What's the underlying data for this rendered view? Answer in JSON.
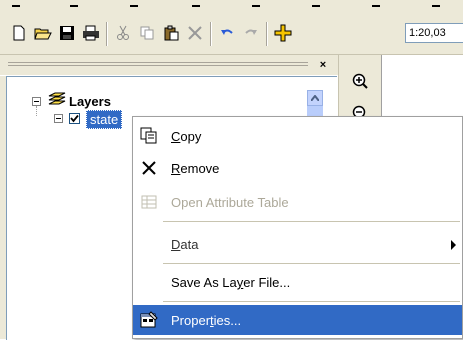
{
  "toolbar": {
    "scale_value": "1:20,03"
  },
  "toc": {
    "close_glyph": "×",
    "root_label": "Layers",
    "layer_label": "state",
    "layer_checked": true
  },
  "menu": {
    "items": [
      {
        "label_pre": "",
        "label_ul": "C",
        "label_post": "opy",
        "icon": "copy-icon",
        "enabled": true
      },
      {
        "label_pre": "",
        "label_ul": "R",
        "label_post": "emove",
        "icon": "remove-icon",
        "enabled": true
      },
      {
        "label_pre": "Open Attribute Table",
        "label_ul": "",
        "label_post": "",
        "icon": "table-icon",
        "enabled": false
      },
      {
        "label_pre": "",
        "label_ul": "D",
        "label_post": "ata",
        "icon": "",
        "enabled": true
      },
      {
        "label_pre": "Save As La",
        "label_ul": "y",
        "label_post": "er File...",
        "icon": "",
        "enabled": true
      },
      {
        "label_pre": "Proper",
        "label_ul": "t",
        "label_post": "ies...",
        "icon": "properties-icon",
        "enabled": true
      }
    ]
  },
  "colors": {
    "selection": "#316ac5",
    "chrome": "#ece9d8"
  }
}
